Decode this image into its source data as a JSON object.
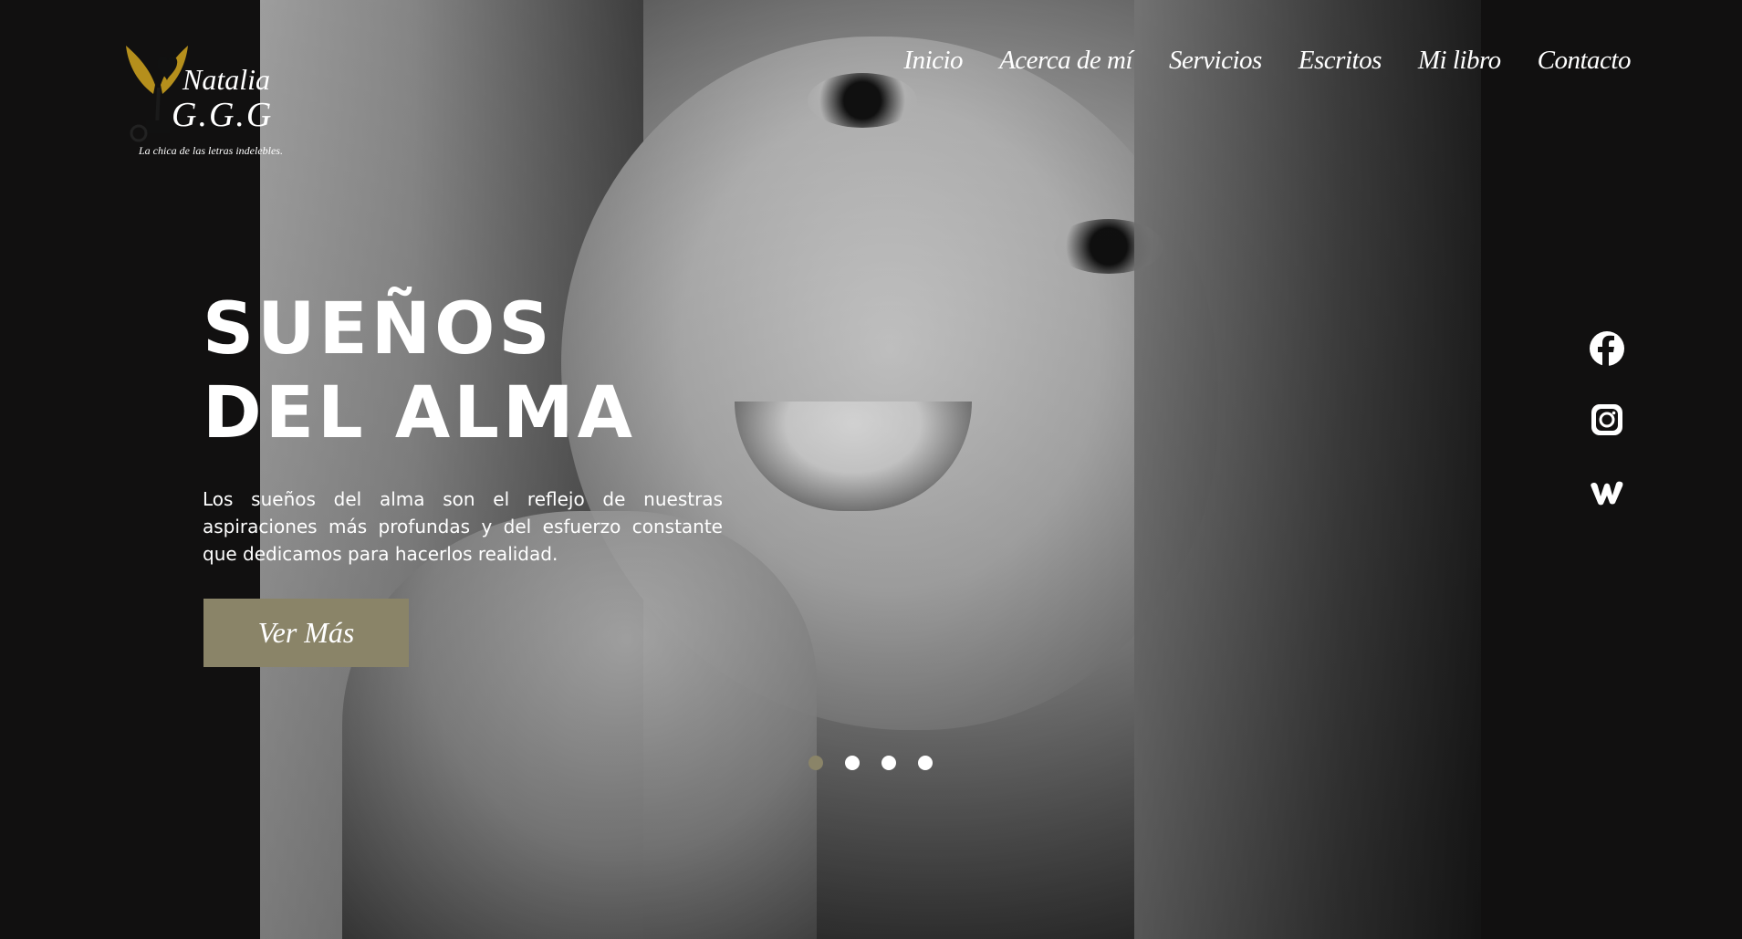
{
  "logo": {
    "name": "Natalia",
    "initials": "G.G.G",
    "tagline": "La chica de las letras indelebles."
  },
  "nav": {
    "items": [
      "Inicio",
      "Acerca de mí",
      "Servicios",
      "Escritos",
      "Mi libro",
      "Contacto"
    ]
  },
  "hero": {
    "title_line1": "SUEÑOS",
    "title_line2": "DEL ALMA",
    "description": "Los sueños del alma son el reflejo de nuestras aspiraciones más profundas y del esfuerzo constante que dedicamos para hacerlos realidad.",
    "cta_label": "Ver Más"
  },
  "social": {
    "icons": [
      "facebook-icon",
      "instagram-icon",
      "wattpad-icon"
    ]
  },
  "slider": {
    "total_slides": 4,
    "active_index": 0
  },
  "colors": {
    "background": "#111010",
    "accent": "#8a8468",
    "logo_gold": "#b58f1c",
    "text": "#ffffff"
  }
}
